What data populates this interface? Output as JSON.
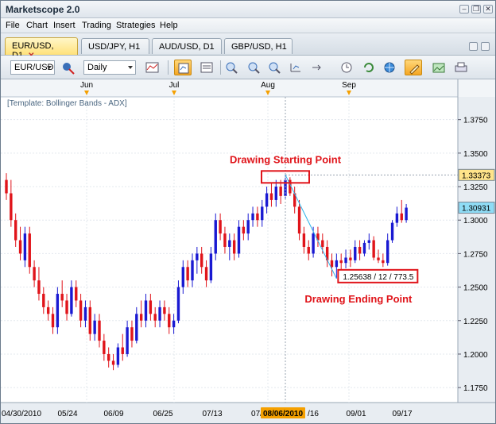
{
  "app": {
    "title": "Marketscope 2.0",
    "window_controls": [
      "minimize-icon",
      "restore-icon",
      "close-icon"
    ]
  },
  "menu": [
    "File",
    "Chart",
    "Insert",
    "Trading",
    "Strategies",
    "Help"
  ],
  "tabs": [
    {
      "label": "EUR/USD, D1",
      "active": true
    },
    {
      "label": "USD/JPY, H1",
      "active": false
    },
    {
      "label": "AUD/USD, D1",
      "active": false
    },
    {
      "label": "GBP/USD, H1",
      "active": false
    }
  ],
  "toolbar": {
    "instrument": "EUR/USD",
    "timeframe": "Daily",
    "icons": [
      "instrument-dropdown",
      "offer-toggle-icon",
      "timeframe-dropdown",
      "indicator-icon",
      "chart-type-icon",
      "template-icon",
      "zoom-in-icon",
      "zoom-out-icon",
      "scroll-left-icon",
      "scroll-right-icon",
      "fit-icon",
      "clock-icon",
      "refresh-icon",
      "globe-icon",
      "pencil-icon",
      "image-icon",
      "print-icon"
    ],
    "active_tool": "pencil-icon"
  },
  "colors": {
    "up_candle": "#1919d2",
    "down_candle": "#e0141a",
    "annotation": "#e0141a",
    "trend_line": "#2fb3ea",
    "price_tag": "#ffe48a",
    "current_price_tag": "#8fdcf5",
    "active_tab": "#ffe27a",
    "month_marker": "#f5a000"
  },
  "chart_data": {
    "type": "candlestick",
    "template_label": "[Template: Bollinger Bands - ADX]",
    "months": [
      "Jun",
      "Jul",
      "Aug",
      "Sep"
    ],
    "x_ticks": [
      "04/30/2010",
      "05/24",
      "06/09",
      "06/25",
      "07/13",
      "07/",
      "08/06/2010",
      "/16",
      "09/01",
      "09/17"
    ],
    "y_ticks": [
      "1.3750",
      "1.3500",
      "1.3250",
      "1.3000",
      "1.2750",
      "1.2500",
      "1.2250",
      "1.2000",
      "1.1750"
    ],
    "ylim": [
      1.165,
      1.392
    ],
    "price_tags": [
      {
        "label": "1.33373",
        "value": 1.33373
      },
      {
        "label": "1.30931",
        "value": 1.30931
      }
    ],
    "annotations": [
      {
        "label": "Drawing Starting Point"
      },
      {
        "label": "Drawing Ending Point"
      }
    ],
    "trend_line": {
      "from": {
        "date": "08/06/2010",
        "price": 1.33373
      },
      "to": {
        "date": "08/26/2010",
        "price": 1.25638
      }
    },
    "measure_label": "1.25638 / 12 / 773.5",
    "candles": [
      [
        1.33,
        1.335,
        1.315,
        1.32
      ],
      [
        1.32,
        1.33,
        1.295,
        1.3
      ],
      [
        1.3,
        1.305,
        1.28,
        1.285
      ],
      [
        1.285,
        1.295,
        1.27,
        1.275
      ],
      [
        1.27,
        1.295,
        1.265,
        1.29
      ],
      [
        1.29,
        1.295,
        1.26,
        1.265
      ],
      [
        1.265,
        1.27,
        1.25,
        1.255
      ],
      [
        1.255,
        1.265,
        1.24,
        1.245
      ],
      [
        1.245,
        1.25,
        1.23,
        1.235
      ],
      [
        1.235,
        1.24,
        1.225,
        1.23
      ],
      [
        1.23,
        1.235,
        1.215,
        1.22
      ],
      [
        1.22,
        1.25,
        1.215,
        1.245
      ],
      [
        1.245,
        1.255,
        1.235,
        1.24
      ],
      [
        1.24,
        1.245,
        1.225,
        1.23
      ],
      [
        1.23,
        1.255,
        1.228,
        1.25
      ],
      [
        1.25,
        1.255,
        1.235,
        1.24
      ],
      [
        1.24,
        1.245,
        1.22,
        1.225
      ],
      [
        1.225,
        1.24,
        1.22,
        1.235
      ],
      [
        1.235,
        1.24,
        1.21,
        1.215
      ],
      [
        1.215,
        1.23,
        1.21,
        1.225
      ],
      [
        1.225,
        1.23,
        1.205,
        1.21
      ],
      [
        1.21,
        1.215,
        1.195,
        1.2
      ],
      [
        1.2,
        1.205,
        1.19,
        1.195
      ],
      [
        1.195,
        1.2,
        1.188,
        1.192
      ],
      [
        1.192,
        1.208,
        1.19,
        1.205
      ],
      [
        1.205,
        1.215,
        1.195,
        1.2
      ],
      [
        1.2,
        1.225,
        1.198,
        1.22
      ],
      [
        1.22,
        1.225,
        1.205,
        1.21
      ],
      [
        1.21,
        1.235,
        1.208,
        1.23
      ],
      [
        1.23,
        1.24,
        1.22,
        1.225
      ],
      [
        1.225,
        1.245,
        1.22,
        1.24
      ],
      [
        1.24,
        1.245,
        1.225,
        1.23
      ],
      [
        1.23,
        1.235,
        1.22,
        1.225
      ],
      [
        1.225,
        1.24,
        1.22,
        1.235
      ],
      [
        1.235,
        1.24,
        1.225,
        1.23
      ],
      [
        1.23,
        1.235,
        1.215,
        1.22
      ],
      [
        1.22,
        1.23,
        1.215,
        1.225
      ],
      [
        1.225,
        1.255,
        1.223,
        1.25
      ],
      [
        1.25,
        1.27,
        1.245,
        1.265
      ],
      [
        1.265,
        1.27,
        1.25,
        1.255
      ],
      [
        1.255,
        1.275,
        1.25,
        1.27
      ],
      [
        1.27,
        1.28,
        1.26,
        1.275
      ],
      [
        1.275,
        1.28,
        1.26,
        1.265
      ],
      [
        1.265,
        1.27,
        1.25,
        1.255
      ],
      [
        1.255,
        1.28,
        1.253,
        1.275
      ],
      [
        1.275,
        1.305,
        1.27,
        1.3
      ],
      [
        1.3,
        1.305,
        1.285,
        1.29
      ],
      [
        1.29,
        1.295,
        1.275,
        1.28
      ],
      [
        1.28,
        1.29,
        1.27,
        1.285
      ],
      [
        1.285,
        1.29,
        1.27,
        1.275
      ],
      [
        1.275,
        1.3,
        1.272,
        1.295
      ],
      [
        1.295,
        1.3,
        1.285,
        1.29
      ],
      [
        1.29,
        1.305,
        1.285,
        1.3
      ],
      [
        1.3,
        1.31,
        1.295,
        1.305
      ],
      [
        1.305,
        1.31,
        1.295,
        1.3
      ],
      [
        1.3,
        1.315,
        1.295,
        1.31
      ],
      [
        1.31,
        1.325,
        1.305,
        1.32
      ],
      [
        1.32,
        1.328,
        1.31,
        1.315
      ],
      [
        1.315,
        1.33,
        1.31,
        1.325
      ],
      [
        1.325,
        1.33,
        1.312,
        1.318
      ],
      [
        1.318,
        1.3337,
        1.315,
        1.33
      ],
      [
        1.33,
        1.332,
        1.318,
        1.32
      ],
      [
        1.32,
        1.325,
        1.305,
        1.31
      ],
      [
        1.31,
        1.315,
        1.285,
        1.29
      ],
      [
        1.29,
        1.295,
        1.275,
        1.28
      ],
      [
        1.28,
        1.285,
        1.27,
        1.275
      ],
      [
        1.275,
        1.295,
        1.272,
        1.29
      ],
      [
        1.29,
        1.295,
        1.28,
        1.285
      ],
      [
        1.285,
        1.29,
        1.275,
        1.28
      ],
      [
        1.28,
        1.285,
        1.265,
        1.27
      ],
      [
        1.27,
        1.275,
        1.258,
        1.265
      ],
      [
        1.265,
        1.275,
        1.2564,
        1.27
      ],
      [
        1.27,
        1.275,
        1.262,
        1.268
      ],
      [
        1.268,
        1.278,
        1.264,
        1.272
      ],
      [
        1.272,
        1.278,
        1.265,
        1.27
      ],
      [
        1.27,
        1.285,
        1.268,
        1.28
      ],
      [
        1.28,
        1.285,
        1.27,
        1.275
      ],
      [
        1.275,
        1.285,
        1.273,
        1.283
      ],
      [
        1.283,
        1.29,
        1.278,
        1.285
      ],
      [
        1.285,
        1.288,
        1.27,
        1.272
      ],
      [
        1.272,
        1.278,
        1.268,
        1.27
      ],
      [
        1.27,
        1.275,
        1.265,
        1.268
      ],
      [
        1.268,
        1.29,
        1.266,
        1.285
      ],
      [
        1.285,
        1.3,
        1.283,
        1.298
      ],
      [
        1.298,
        1.31,
        1.295,
        1.305
      ],
      [
        1.305,
        1.315,
        1.298,
        1.3
      ],
      [
        1.3,
        1.312,
        1.298,
        1.3093
      ]
    ]
  }
}
